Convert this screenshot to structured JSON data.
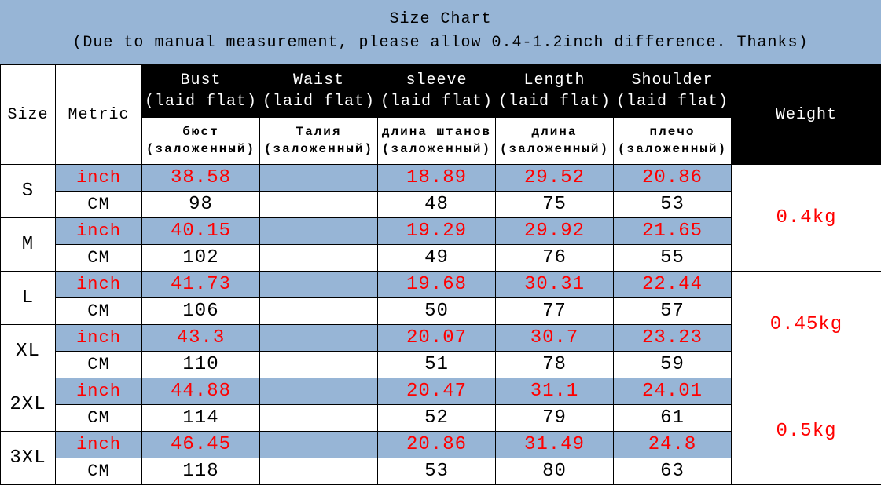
{
  "title": "Size Chart",
  "subtitle": "(Due to manual measurement, please allow 0.4-1.2inch difference. Thanks)",
  "headers": {
    "size": "Size",
    "metric": "Metric",
    "bust": "Bust\n(laid flat)",
    "waist": "Waist\n(laid flat)",
    "sleeve": "sleeve\n(laid flat)",
    "length": "Length\n(laid flat)",
    "shoulder": "Shoulder\n(laid flat)",
    "weight": "Weight"
  },
  "ru_headers": {
    "bust": "бюст (заложенный)",
    "waist": "Талия (заложенный)",
    "sleeve": "длина штанов (заложенный)",
    "length": "длина (заложенный)",
    "shoulder": "плечо (заложенный)"
  },
  "metric_labels": {
    "inch": "inch",
    "cm": "CM"
  },
  "sizes": [
    {
      "name": "S",
      "inch": {
        "bust": "38.58",
        "waist": "",
        "sleeve": "18.89",
        "length": "29.52",
        "shoulder": "20.86"
      },
      "cm": {
        "bust": "98",
        "waist": "",
        "sleeve": "48",
        "length": "75",
        "shoulder": "53"
      }
    },
    {
      "name": "M",
      "inch": {
        "bust": "40.15",
        "waist": "",
        "sleeve": "19.29",
        "length": "29.92",
        "shoulder": "21.65"
      },
      "cm": {
        "bust": "102",
        "waist": "",
        "sleeve": "49",
        "length": "76",
        "shoulder": "55"
      }
    },
    {
      "name": "L",
      "inch": {
        "bust": "41.73",
        "waist": "",
        "sleeve": "19.68",
        "length": "30.31",
        "shoulder": "22.44"
      },
      "cm": {
        "bust": "106",
        "waist": "",
        "sleeve": "50",
        "length": "77",
        "shoulder": "57"
      }
    },
    {
      "name": "XL",
      "inch": {
        "bust": "43.3",
        "waist": "",
        "sleeve": "20.07",
        "length": "30.7",
        "shoulder": "23.23"
      },
      "cm": {
        "bust": "110",
        "waist": "",
        "sleeve": "51",
        "length": "78",
        "shoulder": "59"
      }
    },
    {
      "name": "2XL",
      "inch": {
        "bust": "44.88",
        "waist": "",
        "sleeve": "20.47",
        "length": "31.1",
        "shoulder": "24.01"
      },
      "cm": {
        "bust": "114",
        "waist": "",
        "sleeve": "52",
        "length": "79",
        "shoulder": "61"
      }
    },
    {
      "name": "3XL",
      "inch": {
        "bust": "46.45",
        "waist": "",
        "sleeve": "20.86",
        "length": "31.49",
        "shoulder": "24.8"
      },
      "cm": {
        "bust": "118",
        "waist": "",
        "sleeve": "53",
        "length": "80",
        "shoulder": "63"
      }
    }
  ],
  "weights": [
    "0.4kg",
    "0.45kg",
    "0.5kg"
  ],
  "chart_data": {
    "type": "table",
    "title": "Size Chart",
    "columns": [
      "Size",
      "Metric",
      "Bust (laid flat)",
      "Waist (laid flat)",
      "sleeve (laid flat)",
      "Length (laid flat)",
      "Shoulder (laid flat)",
      "Weight"
    ],
    "rows": [
      [
        "S",
        "inch",
        "38.58",
        "",
        "18.89",
        "29.52",
        "20.86",
        "0.4kg"
      ],
      [
        "S",
        "CM",
        "98",
        "",
        "48",
        "75",
        "53",
        "0.4kg"
      ],
      [
        "M",
        "inch",
        "40.15",
        "",
        "19.29",
        "29.92",
        "21.65",
        "0.4kg"
      ],
      [
        "M",
        "CM",
        "102",
        "",
        "49",
        "76",
        "55",
        "0.4kg"
      ],
      [
        "L",
        "inch",
        "41.73",
        "",
        "19.68",
        "30.31",
        "22.44",
        "0.45kg"
      ],
      [
        "L",
        "CM",
        "106",
        "",
        "50",
        "77",
        "57",
        "0.45kg"
      ],
      [
        "XL",
        "inch",
        "43.3",
        "",
        "20.07",
        "30.7",
        "23.23",
        "0.45kg"
      ],
      [
        "XL",
        "CM",
        "110",
        "",
        "51",
        "78",
        "59",
        "0.45kg"
      ],
      [
        "2XL",
        "inch",
        "44.88",
        "",
        "20.47",
        "31.1",
        "24.01",
        "0.5kg"
      ],
      [
        "2XL",
        "CM",
        "114",
        "",
        "52",
        "79",
        "61",
        "0.5kg"
      ],
      [
        "3XL",
        "inch",
        "46.45",
        "",
        "20.86",
        "31.49",
        "24.8",
        "0.5kg"
      ],
      [
        "3XL",
        "CM",
        "118",
        "",
        "53",
        "80",
        "63",
        "0.5kg"
      ]
    ]
  }
}
